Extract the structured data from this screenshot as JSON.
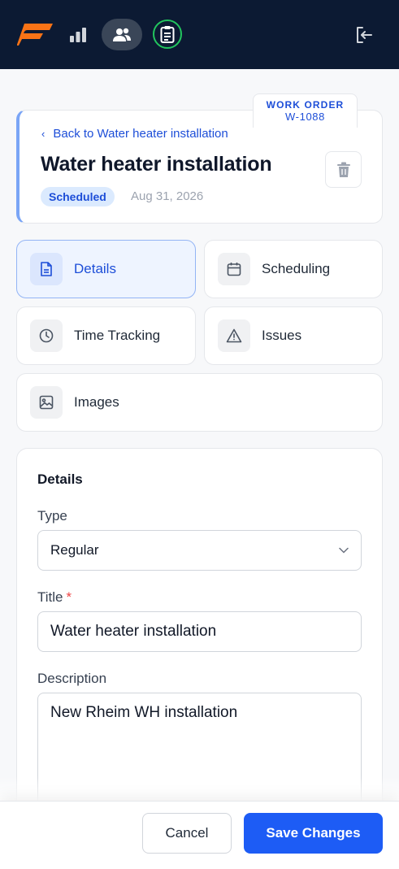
{
  "nav": {
    "logo": "brand-logo",
    "items": [
      {
        "icon": "bar-chart-icon"
      },
      {
        "icon": "users-icon"
      },
      {
        "icon": "clipboard-icon"
      },
      {
        "icon": "logout-icon"
      }
    ],
    "colors": {
      "background": "#0c1a33",
      "logo": "#f97316",
      "active_ring": "#22c55e"
    }
  },
  "header": {
    "wo_label": "WORK ORDER",
    "wo_number": "W-1088",
    "back_text": "Back to Water heater installation",
    "title": "Water heater installation",
    "status": "Scheduled",
    "date": "Aug 31, 2026"
  },
  "tabs": [
    {
      "label": "Details",
      "icon": "document-icon",
      "active": true
    },
    {
      "label": "Scheduling",
      "icon": "calendar-icon",
      "active": false
    },
    {
      "label": "Time Tracking",
      "icon": "clock-icon",
      "active": false
    },
    {
      "label": "Issues",
      "icon": "warning-icon",
      "active": false
    },
    {
      "label": "Images",
      "icon": "image-icon",
      "active": false
    }
  ],
  "form": {
    "section_title": "Details",
    "type_label": "Type",
    "type_value": "Regular",
    "title_label": "Title",
    "required_mark": "*",
    "title_value": "Water heater installation",
    "description_label": "Description",
    "description_value": "New Rheim WH installation"
  },
  "footer": {
    "cancel_label": "Cancel",
    "save_label": "Save Changes"
  },
  "colors": {
    "accent": "#1d5cf5",
    "status_bg": "#dbeafe",
    "status_text": "#1d4ed8"
  }
}
